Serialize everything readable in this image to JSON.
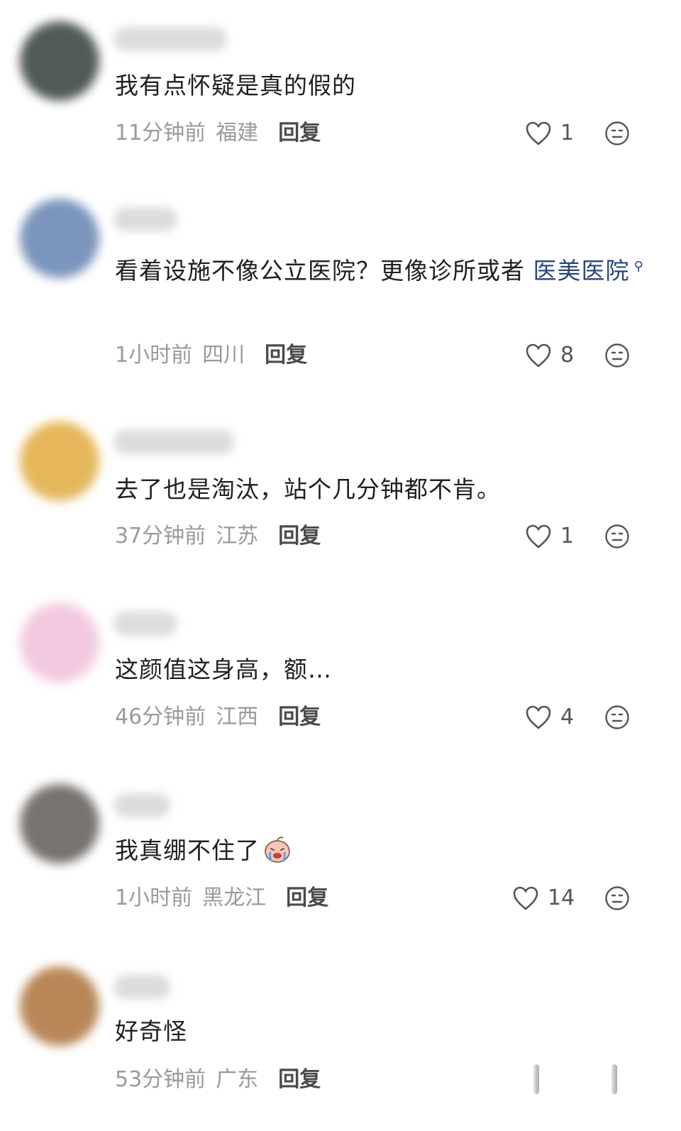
{
  "comments": [
    {
      "text": "我有点怀疑是真的假的",
      "time": "11分钟前",
      "location": "福建",
      "reply": "回复",
      "likes": "1",
      "avatar_color": "#3e4a45"
    },
    {
      "text": "看着设施不像公立医院？更像诊所或者 ",
      "link": "医美医院",
      "time": "1小时前",
      "location": "四川",
      "reply": "回复",
      "likes": "8",
      "avatar_color": "#6d8ab5"
    },
    {
      "text": "去了也是淘汰，站个几分钟都不肯。",
      "time": "37分钟前",
      "location": "江苏",
      "reply": "回复",
      "likes": "1",
      "avatar_color": "#e2b04a"
    },
    {
      "text": "这颜值这身高，额…",
      "time": "46分钟前",
      "location": "江西",
      "reply": "回复",
      "likes": "4",
      "avatar_color": "#f1c4dc"
    },
    {
      "text": "我真绷不住了",
      "time": "1小时前",
      "location": "黑龙江",
      "reply": "回复",
      "likes": "14",
      "avatar_color": "#6b6460"
    },
    {
      "text": "好奇怪",
      "time": "53分钟前",
      "location": "广东",
      "reply": "回复",
      "likes": "",
      "avatar_color": "#b27a45"
    }
  ],
  "icons": {
    "like": "heart-outline-icon",
    "more": "neutral-face-icon",
    "emoji": "crying-laughing-emoji"
  }
}
